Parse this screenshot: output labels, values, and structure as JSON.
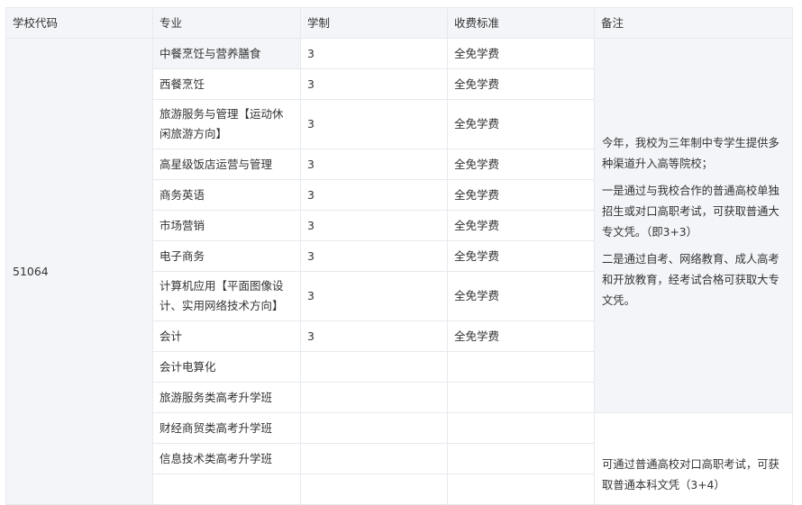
{
  "table": {
    "headers": {
      "code": "学校代码",
      "major": "专业",
      "duration": "学制",
      "fee": "收费标准",
      "note": "备注"
    },
    "school_code": "51064",
    "rows": [
      {
        "major": "中餐烹饪与营养膳食",
        "duration": "3",
        "fee": "全免学费"
      },
      {
        "major": "西餐烹饪",
        "duration": "3",
        "fee": "全免学费"
      },
      {
        "major": "旅游服务与管理【运动休闲旅游方向】",
        "duration": "3",
        "fee": "全免学费"
      },
      {
        "major": "高星级饭店运营与管理",
        "duration": "3",
        "fee": "全免学费"
      },
      {
        "major": "商务英语",
        "duration": "3",
        "fee": "全免学费"
      },
      {
        "major": "市场营销",
        "duration": "3",
        "fee": "全免学费"
      },
      {
        "major": "电子商务",
        "duration": "3",
        "fee": "全免学费"
      },
      {
        "major": "计算机应用【平面图像设计、实用网络技术方向】",
        "duration": "3",
        "fee": "全免学费"
      },
      {
        "major": "会计",
        "duration": "3",
        "fee": "全免学费"
      },
      {
        "major": "会计电算化",
        "duration": "",
        "fee": ""
      },
      {
        "major": "旅游服务类高考升学班",
        "duration": "",
        "fee": ""
      },
      {
        "major": "财经商贸类高考升学班",
        "duration": "",
        "fee": ""
      },
      {
        "major": "信息技术类高考升学班",
        "duration": "",
        "fee": ""
      }
    ],
    "note_group_1": [
      "今年，我校为三年制中专学生提供多种渠道升入高等院校；",
      "一是通过与我校合作的普通高校单独招生或对口高职考试，可获取普通大专文凭。（即3+3）",
      "二是通过自考、网络教育、成人高考和开放教育，经考试合格可获取大专文凭。"
    ],
    "note_group_2": "可通过普通高校对口高职考试，可获取普通本科文凭（3+4）"
  }
}
